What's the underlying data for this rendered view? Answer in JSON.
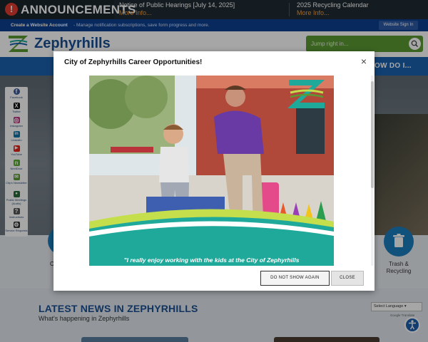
{
  "announcements": {
    "title": "ANNOUNCEMENTS",
    "items": [
      {
        "text": "Notice of Public Hearings [July 14, 2025]",
        "more": "More Info..."
      },
      {
        "text": "2025 Recycling Calendar",
        "more": "More Info..."
      }
    ]
  },
  "account_bar": {
    "lead": "Create a Website Account",
    "rest": "- Manage notification subscriptions, save form progress and more.",
    "sign_in": "Website Sign In"
  },
  "header": {
    "logo_text": "Zephyrhills",
    "search_placeholder": "Jump right in..."
  },
  "nav": {
    "how_do_i": "OW DO I..."
  },
  "social": [
    {
      "label": "Facebook",
      "icon": "facebook-icon",
      "color": "#3b5998",
      "glyph": "f"
    },
    {
      "label": "Twitter",
      "icon": "x-icon",
      "color": "#111111",
      "glyph": "X"
    },
    {
      "label": "Instagram",
      "icon": "instagram-icon",
      "color": "#c13584",
      "glyph": "◎"
    },
    {
      "label": "LinkedIn",
      "icon": "linkedin-icon",
      "color": "#0e76a8",
      "glyph": "in"
    },
    {
      "label": "YouTube",
      "icon": "youtube-icon",
      "color": "#e62117",
      "glyph": "▶"
    },
    {
      "label": "NextDoor",
      "icon": "nextdoor-icon",
      "color": "#5ab031",
      "glyph": "n"
    },
    {
      "label": "City's Newsletter",
      "icon": "newsletter-icon",
      "color": "#5b9a33",
      "glyph": "✉"
    },
    {
      "label": "Public Meetings (Audio)",
      "icon": "microphone-icon",
      "color": "#2a6c3a",
      "glyph": "●"
    },
    {
      "label": "Instructions",
      "icon": "instructions-icon",
      "color": "#555555",
      "glyph": "?"
    },
    {
      "label": "Service Requests",
      "icon": "service-request-icon",
      "color": "#333333",
      "glyph": "⚙"
    }
  ],
  "quick_links": {
    "left_partial": "C",
    "trash": "Trash & Recycling"
  },
  "news": {
    "title": "LATEST NEWS IN ZEPHYRHILLS",
    "subtitle": "What's happening in Zephyrhills"
  },
  "translate": {
    "select": "Select Language",
    "powered": "Google Translate"
  },
  "modal": {
    "title": "City of Zephyrhills Career Opportunities!",
    "caption": "\"I really enjoy working with the kids at the City of Zephyrhills",
    "dont_show": "DO NOT SHOW AGAIN",
    "close": "CLOSE"
  },
  "colors": {
    "brand_blue": "#1b62b0",
    "brand_green": "#5b9a33",
    "teal": "#1fa99a"
  }
}
